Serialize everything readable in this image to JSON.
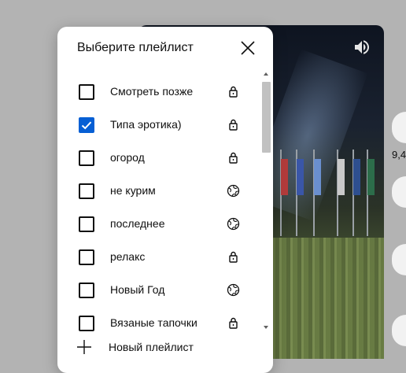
{
  "dialog": {
    "title": "Выберите плейлист",
    "new_playlist_label": "Новый плейлист"
  },
  "playlists": [
    {
      "label": "Смотреть позже",
      "checked": false,
      "privacy": "lock-icon"
    },
    {
      "label": "Типа эротика)",
      "checked": true,
      "privacy": "lock-icon"
    },
    {
      "label": "огород",
      "checked": false,
      "privacy": "lock-icon"
    },
    {
      "label": "не курим",
      "checked": false,
      "privacy": "globe-icon"
    },
    {
      "label": "последнее",
      "checked": false,
      "privacy": "globe-icon"
    },
    {
      "label": "релакс",
      "checked": false,
      "privacy": "lock-icon"
    },
    {
      "label": "Новый Год",
      "checked": false,
      "privacy": "globe-icon"
    },
    {
      "label": "Вязаные тапочки",
      "checked": false,
      "privacy": "lock-icon"
    }
  ],
  "background": {
    "side_count": "9,4"
  },
  "colors": {
    "accent": "#065fd4",
    "text": "#0f0f0f"
  }
}
